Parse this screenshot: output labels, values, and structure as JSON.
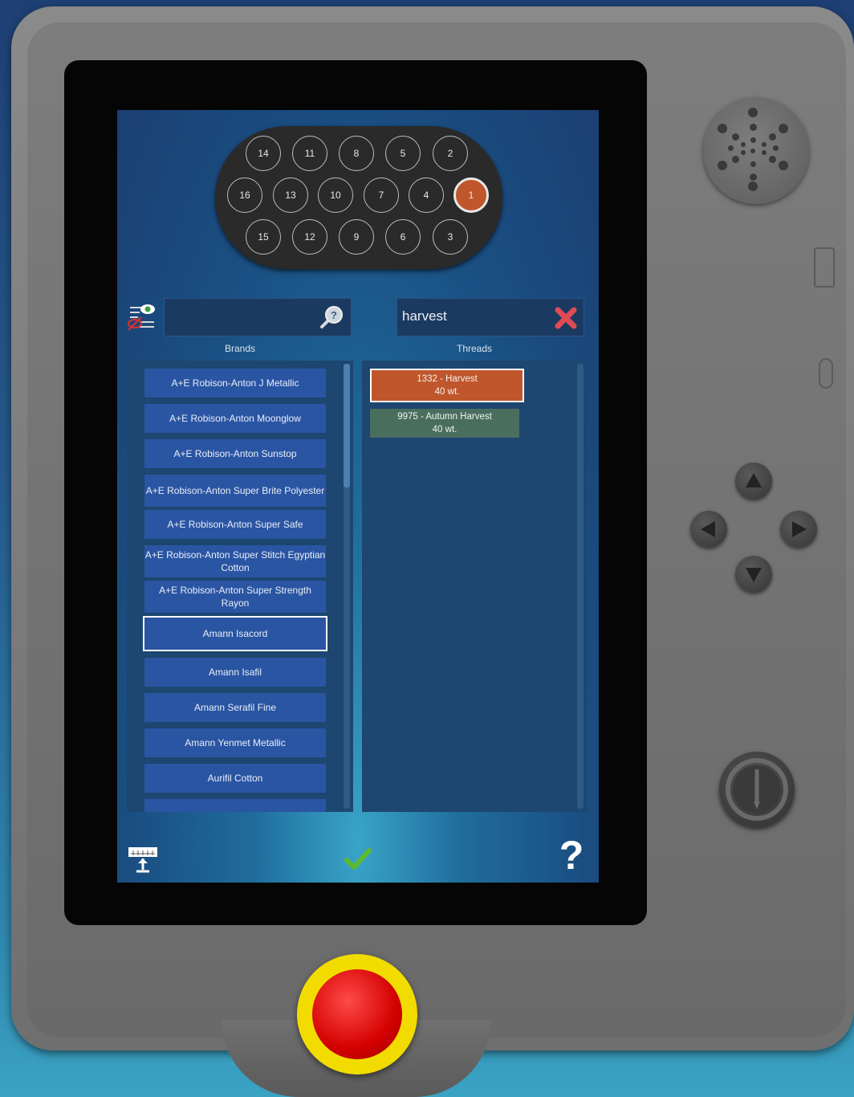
{
  "needles": [
    {
      "label": "14"
    },
    {
      "label": "11"
    },
    {
      "label": "8"
    },
    {
      "label": "5"
    },
    {
      "label": "2"
    },
    {
      "label": "16"
    },
    {
      "label": "13"
    },
    {
      "label": "10"
    },
    {
      "label": "7"
    },
    {
      "label": "4"
    },
    {
      "label": "1"
    },
    {
      "label": "15"
    },
    {
      "label": "12"
    },
    {
      "label": "9"
    },
    {
      "label": "6"
    },
    {
      "label": "3"
    }
  ],
  "active_needle": "1",
  "brand_search": {
    "value": ""
  },
  "thread_filter": {
    "value": "harvest"
  },
  "headers": {
    "brands": "Brands",
    "threads": "Threads"
  },
  "brands": [
    "A+E Robison-Anton J Metallic",
    "A+E Robison-Anton Moonglow",
    "A+E Robison-Anton Sunstop",
    "A+E Robison-Anton Super Brite Polyester",
    "A+E Robison-Anton Super Safe",
    "A+E Robison-Anton Super Stitch Egyptian Cotton",
    "A+E Robison-Anton Super Strength Rayon",
    "Amann Isacord",
    "Amann Isafil",
    "Amann Serafil Fine",
    "Amann Yenmet Metallic",
    "Aurifil Cotton",
    ""
  ],
  "selected_brand": "Amann Isacord",
  "threads": [
    {
      "name": "1332 - Harvest",
      "weight": "40 wt.",
      "color": "#c0562b",
      "selected": true
    },
    {
      "name": "9975 - Autumn Harvest",
      "weight": "40 wt.",
      "color": "#4a6e5e",
      "selected": false
    }
  ],
  "icons": {
    "visibility_toggle": "eye-list-icon",
    "search": "search-icon",
    "clear": "close-icon",
    "embroidery_frame": "hoop-icon",
    "confirm": "check-icon",
    "help": "help-icon"
  },
  "help_label": "?"
}
